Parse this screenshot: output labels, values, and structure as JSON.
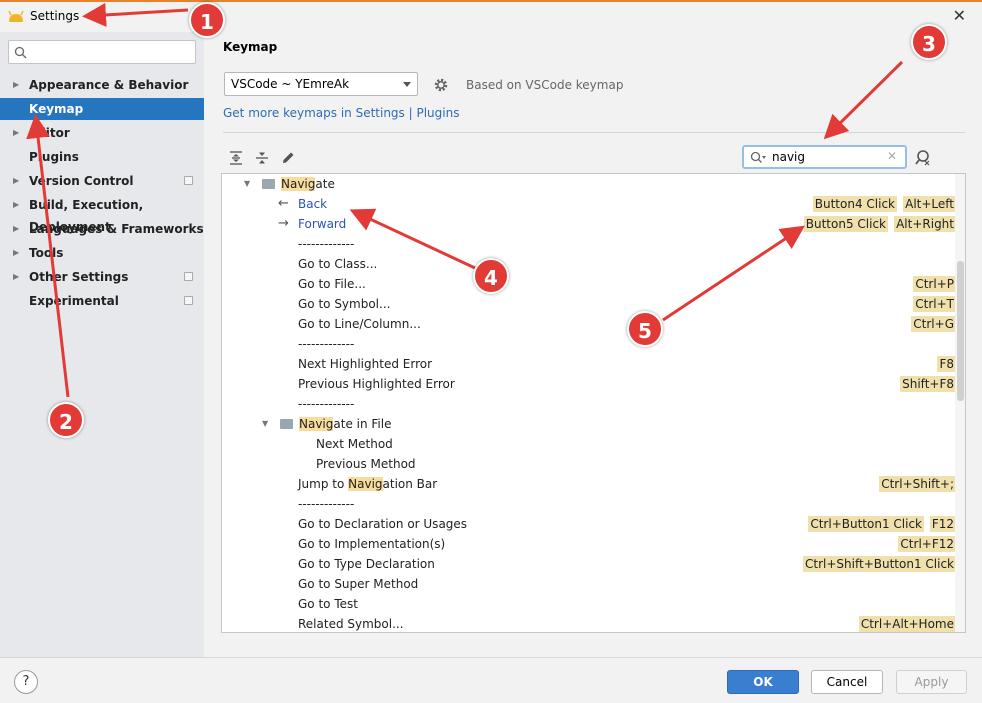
{
  "window": {
    "title": "Settings"
  },
  "sidebar": {
    "items": [
      {
        "label": "Appearance & Behavior",
        "expandable": true,
        "project_icon": false,
        "selected": false
      },
      {
        "label": "Keymap",
        "expandable": false,
        "project_icon": false,
        "selected": true
      },
      {
        "label": "Editor",
        "expandable": true,
        "project_icon": false,
        "selected": false
      },
      {
        "label": "Plugins",
        "expandable": false,
        "project_icon": false,
        "selected": false
      },
      {
        "label": "Version Control",
        "expandable": true,
        "project_icon": true,
        "selected": false
      },
      {
        "label": "Build, Execution, Deployment",
        "expandable": true,
        "project_icon": false,
        "selected": false
      },
      {
        "label": "Languages & Frameworks",
        "expandable": true,
        "project_icon": false,
        "selected": false
      },
      {
        "label": "Tools",
        "expandable": true,
        "project_icon": false,
        "selected": false
      },
      {
        "label": "Other Settings",
        "expandable": true,
        "project_icon": true,
        "selected": false
      },
      {
        "label": "Experimental",
        "expandable": false,
        "project_icon": true,
        "selected": false
      }
    ]
  },
  "main": {
    "breadcrumb": "Keymap",
    "keymap_select": "VSCode ~ YEmreAk",
    "based_on": "Based on VSCode keymap",
    "get_more_link": "Get more keymaps in Settings | Plugins",
    "search_value": "navig"
  },
  "tree": [
    {
      "kind": "group",
      "pre": "",
      "hl": "Navig",
      "post": "ate",
      "indent": 0
    },
    {
      "kind": "action",
      "text": "Back",
      "icon": "←",
      "blue": true,
      "indent": 1,
      "keys": [
        "Alt+Left",
        "Button4 Click"
      ]
    },
    {
      "kind": "action",
      "text": "Forward",
      "icon": "→",
      "blue": true,
      "indent": 1,
      "keys": [
        "Alt+Right",
        "Button5 Click"
      ]
    },
    {
      "kind": "action",
      "text": "-------------",
      "indent": 1,
      "keys": []
    },
    {
      "kind": "action",
      "text": "Go to Class...",
      "indent": 1,
      "keys": []
    },
    {
      "kind": "action",
      "text": "Go to File...",
      "indent": 1,
      "keys": [
        "Ctrl+P"
      ]
    },
    {
      "kind": "action",
      "text": "Go to Symbol...",
      "indent": 1,
      "keys": [
        "Ctrl+T"
      ]
    },
    {
      "kind": "action",
      "text": "Go to Line/Column...",
      "indent": 1,
      "keys": [
        "Ctrl+G"
      ]
    },
    {
      "kind": "action",
      "text": "-------------",
      "indent": 1,
      "keys": []
    },
    {
      "kind": "action",
      "text": "Next Highlighted Error",
      "indent": 1,
      "keys": [
        "F8"
      ]
    },
    {
      "kind": "action",
      "text": "Previous Highlighted Error",
      "indent": 1,
      "keys": [
        "Shift+F8"
      ]
    },
    {
      "kind": "action",
      "text": "-------------",
      "indent": 1,
      "keys": []
    },
    {
      "kind": "group",
      "pre": "",
      "hl": "Navig",
      "post": "ate in File",
      "indent": 1
    },
    {
      "kind": "action",
      "text": "Next Method",
      "indent": 2,
      "keys": []
    },
    {
      "kind": "action",
      "text": "Previous Method",
      "indent": 2,
      "keys": []
    },
    {
      "kind": "action_hl",
      "pre": "Jump to ",
      "hl": "Navig",
      "post": "ation Bar",
      "indent": 1,
      "keys": [
        "Ctrl+Shift+;"
      ]
    },
    {
      "kind": "action",
      "text": "-------------",
      "indent": 1,
      "keys": []
    },
    {
      "kind": "action",
      "text": "Go to Declaration or Usages",
      "indent": 1,
      "keys": [
        "F12",
        "Ctrl+Button1 Click"
      ]
    },
    {
      "kind": "action",
      "text": "Go to Implementation(s)",
      "indent": 1,
      "keys": [
        "Ctrl+F12"
      ]
    },
    {
      "kind": "action",
      "text": "Go to Type Declaration",
      "indent": 1,
      "keys": [
        "Ctrl+Shift+Button1 Click"
      ]
    },
    {
      "kind": "action",
      "text": "Go to Super Method",
      "indent": 1,
      "keys": []
    },
    {
      "kind": "action",
      "text": "Go to Test",
      "indent": 1,
      "keys": []
    },
    {
      "kind": "action",
      "text": "Related Symbol...",
      "indent": 1,
      "keys": [
        "Ctrl+Alt+Home"
      ]
    }
  ],
  "footer": {
    "help": "?",
    "ok": "OK",
    "cancel": "Cancel",
    "apply": "Apply"
  },
  "annotations": [
    "1",
    "2",
    "3",
    "4",
    "5"
  ],
  "colors": {
    "selection": "#2675bf",
    "highlight": "#f7dc9b",
    "shortcut_bg": "#efe0ac",
    "annotation": "#e23a36",
    "link": "#2e6bb5"
  }
}
